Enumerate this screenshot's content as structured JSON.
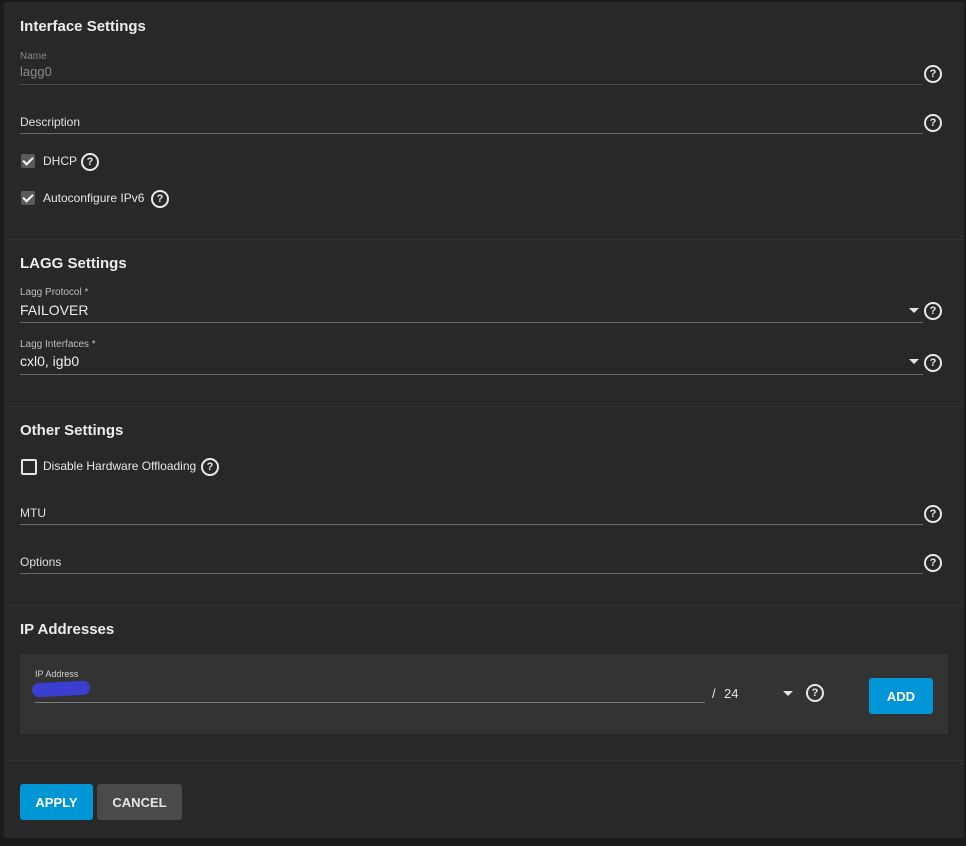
{
  "interface_settings": {
    "title": "Interface Settings",
    "name_label": "Name",
    "name_value": "lagg0",
    "description_placeholder": "Description",
    "dhcp_label": "DHCP",
    "dhcp_checked": true,
    "autoconf_label": "Autoconfigure IPv6",
    "autoconf_checked": true
  },
  "lagg_settings": {
    "title": "LAGG Settings",
    "protocol_label": "Lagg Protocol *",
    "protocol_value": "FAILOVER",
    "interfaces_label": "Lagg Interfaces *",
    "interfaces_value": "cxl0, igb0"
  },
  "other_settings": {
    "title": "Other Settings",
    "disable_offloading_label": "Disable Hardware Offloading",
    "disable_offloading_checked": false,
    "mtu_placeholder": "MTU",
    "options_placeholder": "Options"
  },
  "ip_addresses": {
    "title": "IP Addresses",
    "ip_label": "IP Address",
    "separator": "/",
    "netmask_value": "24",
    "add_label": "ADD"
  },
  "actions": {
    "apply_label": "APPLY",
    "cancel_label": "CANCEL"
  },
  "icons": {
    "help": "help-circle-icon",
    "check": "check-icon",
    "dropdown": "chevron-down-icon"
  },
  "colors": {
    "accent": "#0095d5",
    "background": "#282828",
    "panel": "#333333"
  }
}
